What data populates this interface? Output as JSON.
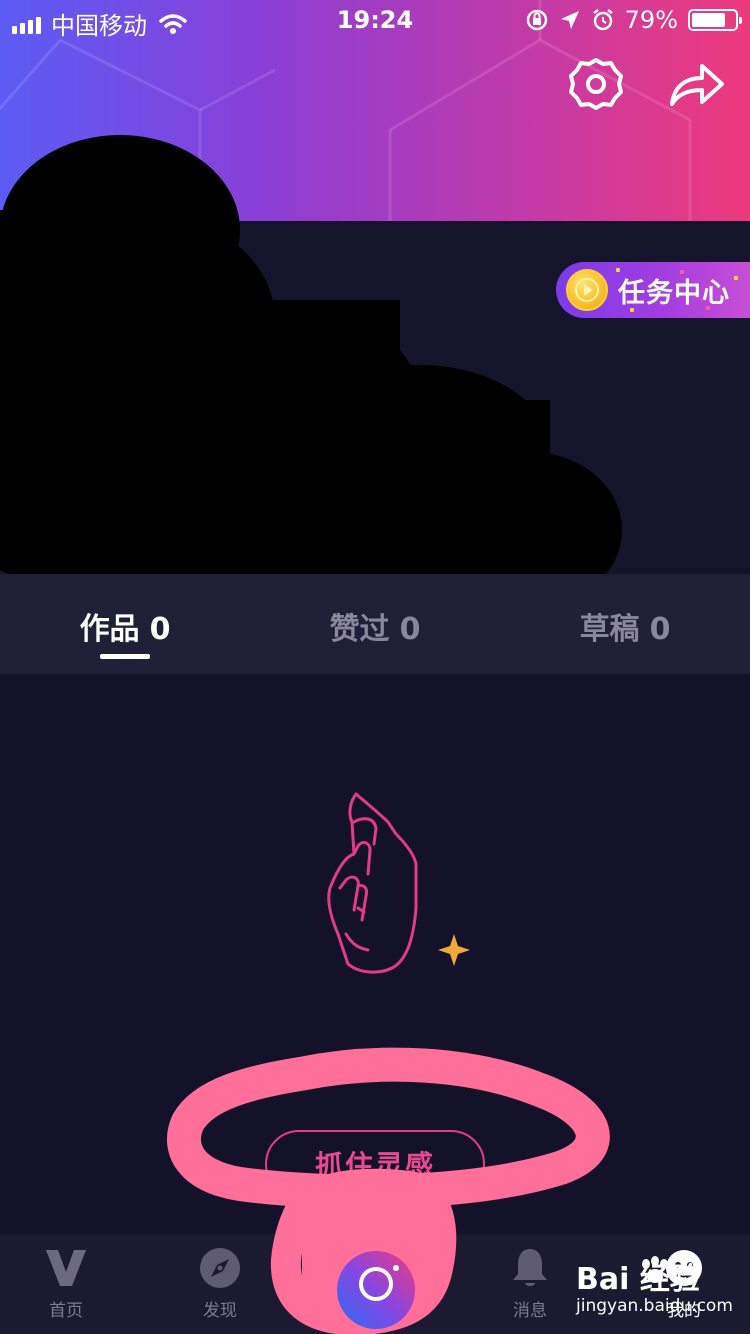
{
  "status_bar": {
    "carrier": "中国移动",
    "time": "19:24",
    "battery_percent": "79%",
    "battery_level": 0.79
  },
  "header": {
    "settings_icon": "gear-icon",
    "share_icon": "share-arrow-icon"
  },
  "task_center": {
    "label": "任务中心",
    "icon": "play-coin-icon"
  },
  "tabs": [
    {
      "label": "作品",
      "count": "0",
      "active": true
    },
    {
      "label": "赞过",
      "count": "0",
      "active": false
    },
    {
      "label": "草稿",
      "count": "0",
      "active": false
    }
  ],
  "empty_state": {
    "illustration": "snapping-hand-icon",
    "text": "",
    "button_label": "抓住灵感"
  },
  "bottom_nav": [
    {
      "label": "首页",
      "icon": "v-logo-icon"
    },
    {
      "label": "发现",
      "icon": "compass-icon"
    },
    {
      "label": "",
      "icon": "camera-ring-icon"
    },
    {
      "label": "消息",
      "icon": "bell-icon"
    },
    {
      "label": "我的",
      "icon": "profile-icon"
    }
  ],
  "watermark": {
    "brand": "Bai  经验",
    "sub": "jingyan.baidu.com"
  },
  "colors": {
    "header_gradient_start": "#5b5cf5",
    "header_gradient_end": "#ee3a7c",
    "background": "#14122b",
    "accent_pink": "#e53d86",
    "annotation": "#ff6f9a"
  }
}
